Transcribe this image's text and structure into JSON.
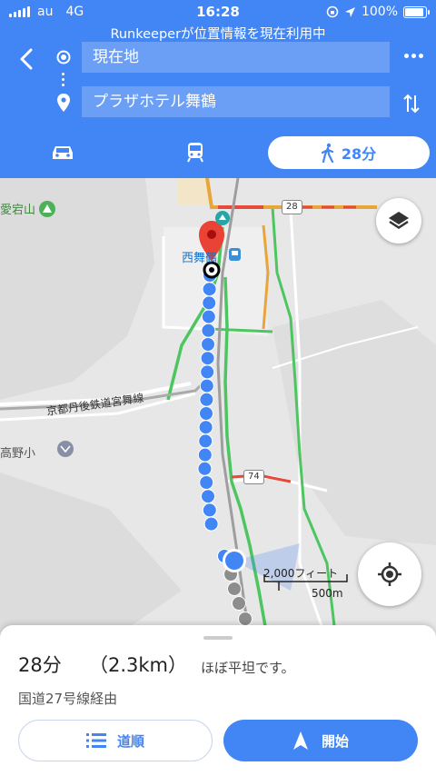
{
  "status_bar": {
    "carrier": "au",
    "network": "4G",
    "time": "16:28",
    "battery": "100%",
    "battery_level": 1.0
  },
  "banner": "Runkeeperが位置情報を現在利用中",
  "directions": {
    "origin": "現在地",
    "destination": "プラザホテル舞鶴",
    "modes": {
      "walk_time": "28分"
    }
  },
  "map": {
    "labels": {
      "mountain": "愛宕山",
      "station": "西舞鶴",
      "railway": "京都丹後鉄道宮舞線",
      "school": "高野小"
    },
    "route_shields": [
      "28",
      "74"
    ],
    "scale": {
      "imperial": "2,000フィート",
      "metric": "500m"
    }
  },
  "summary": {
    "duration": "28分",
    "distance": "（2.3km）",
    "terrain": "ほぼ平坦です。",
    "via": "国道27号線経由",
    "steps_label": "道順",
    "start_label": "開始"
  },
  "colors": {
    "accent": "#4285f4",
    "route_dot": "#4285f4",
    "walked_dot": "#8d8d8d",
    "pin": "#ea4335"
  }
}
